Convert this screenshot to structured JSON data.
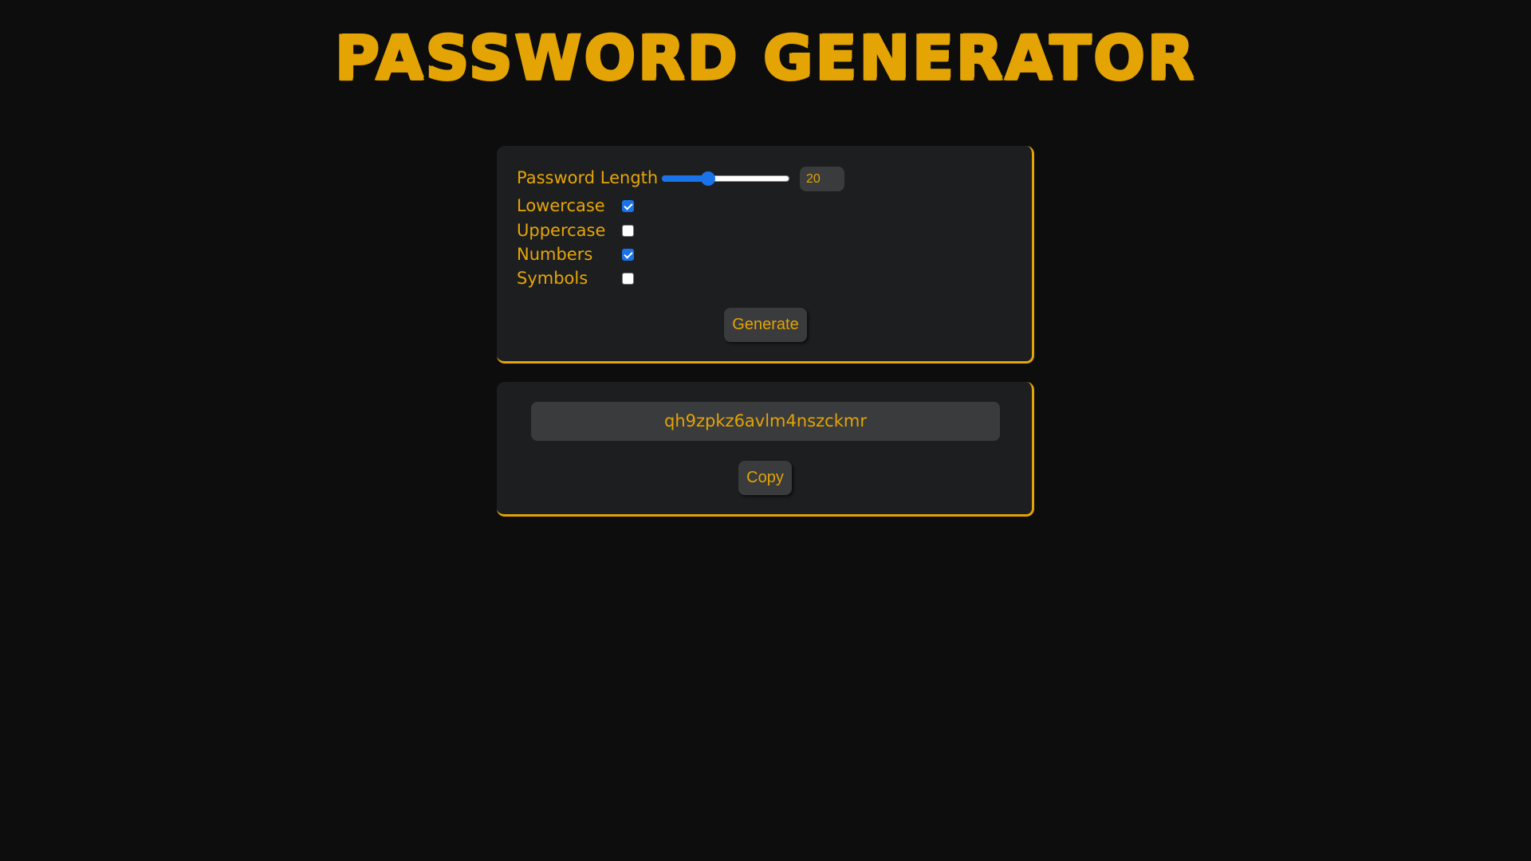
{
  "app": {
    "title": "PASSWORD GENERATOR"
  },
  "settings": {
    "length_label": "Password Length",
    "length_value": "20",
    "length_slider_fraction": 0.36,
    "options": [
      {
        "label": "Lowercase",
        "checked": true
      },
      {
        "label": "Uppercase",
        "checked": false
      },
      {
        "label": "Numbers",
        "checked": true
      },
      {
        "label": "Symbols",
        "checked": false
      }
    ],
    "generate_label": "Generate"
  },
  "output": {
    "password": "qh9zpkz6avlm4nszckmr",
    "copy_label": "Copy"
  },
  "colors": {
    "background": "#0d0d0e",
    "card": "#1d1e20",
    "accent": "#e3a404",
    "control": "#3a3b3d",
    "checkbox_checked": "#1a73e8"
  }
}
